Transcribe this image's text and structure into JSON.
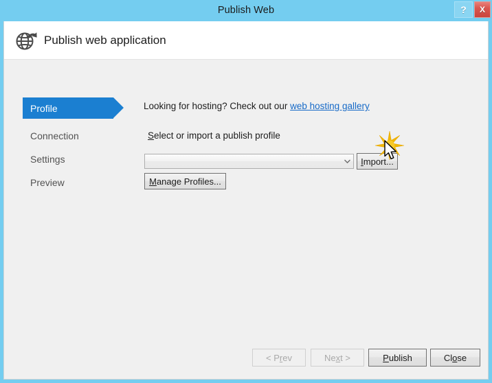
{
  "window": {
    "title": "Publish Web",
    "help_label": "?",
    "close_label": "X",
    "frame_color": "#74cdf0",
    "accent_color": "#1b7fd1"
  },
  "header": {
    "icon": "globe-publish-icon",
    "title": "Publish web application"
  },
  "sidebar": {
    "items": [
      {
        "label": "Profile",
        "active": true
      },
      {
        "label": "Connection",
        "active": false
      },
      {
        "label": "Settings",
        "active": false
      },
      {
        "label": "Preview",
        "active": false
      }
    ]
  },
  "main": {
    "hosting_prompt": "Looking for hosting? Check out our ",
    "hosting_link": "web hosting gallery",
    "profile_label_prefix": "S",
    "profile_label_rest": "elect or import a publish profile",
    "profile_combo": {
      "value": "",
      "placeholder": "",
      "arrow_icon": "chevron-down-icon"
    },
    "import_button": {
      "accel": "I",
      "rest": "mport..."
    },
    "manage_button": {
      "accel": "M",
      "rest": "anage Profiles..."
    }
  },
  "footer": {
    "prev": {
      "pre": "< P",
      "accel": "r",
      "post": "ev",
      "disabled": true
    },
    "next": {
      "pre": "Ne",
      "accel": "x",
      "post": "t >",
      "disabled": true
    },
    "publish": {
      "pre": "",
      "accel": "P",
      "post": "ublish",
      "disabled": false
    },
    "close": {
      "pre": "Cl",
      "accel": "o",
      "post": "se",
      "disabled": false
    }
  },
  "overlay": {
    "cursor": "mouse-pointer-cursor",
    "click_effect": "click-burst-icon"
  }
}
